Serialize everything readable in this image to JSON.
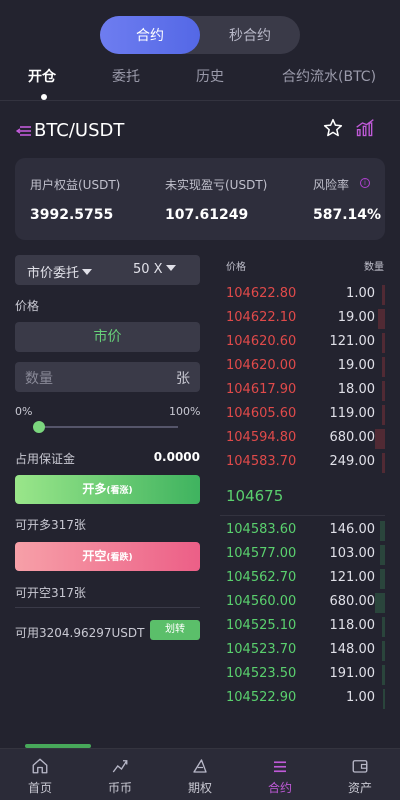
{
  "mode_toggle": {
    "contract": "合约",
    "second_contract": "秒合约"
  },
  "tabs": [
    "开仓",
    "委托",
    "历史",
    "合约流水(BTC)"
  ],
  "pair": {
    "name": "BTC/USDT"
  },
  "account": {
    "equity_label": "用户权益(USDT)",
    "equity_value": "3992.5755",
    "unrealized_label": "未实现盈亏(USDT)",
    "unrealized_value": "107.61249",
    "risk_label": "风险率",
    "risk_value": "587.14%"
  },
  "order_form": {
    "order_type": "市价委托",
    "leverage": "50 X",
    "price_label": "价格",
    "price_value": "市价",
    "qty_placeholder": "数量",
    "qty_unit": "张",
    "slider_min": "0%",
    "slider_max": "100%",
    "slider_value": 0.0,
    "margin_label": "占用保证金",
    "margin_value": "0.0000",
    "long_button": "开多",
    "long_sub": "(看涨)",
    "long_available": "可开多317张",
    "short_button": "开空",
    "short_sub": "(看跌)",
    "short_available": "可开空317张",
    "available_balance": "可用3204.96297USDT",
    "transfer_button": "划转"
  },
  "orderbook": {
    "price_header": "价格",
    "qty_header": "数量",
    "asks": [
      {
        "price": "104622.80",
        "qty": "1.00",
        "depth": 0.02
      },
      {
        "price": "104622.10",
        "qty": "19.00",
        "depth": 0.04
      },
      {
        "price": "104620.60",
        "qty": "121.00",
        "depth": 0.02
      },
      {
        "price": "104620.00",
        "qty": "19.00",
        "depth": 0.02
      },
      {
        "price": "104617.90",
        "qty": "18.00",
        "depth": 0.02
      },
      {
        "price": "104605.60",
        "qty": "119.00",
        "depth": 0.02
      },
      {
        "price": "104594.80",
        "qty": "680.00",
        "depth": 0.06
      },
      {
        "price": "104583.70",
        "qty": "249.00",
        "depth": 0.02
      }
    ],
    "last_price": "104675",
    "bids": [
      {
        "price": "104583.60",
        "qty": "146.00",
        "depth": 0.03
      },
      {
        "price": "104577.00",
        "qty": "103.00",
        "depth": 0.03
      },
      {
        "price": "104562.70",
        "qty": "121.00",
        "depth": 0.03
      },
      {
        "price": "104560.00",
        "qty": "680.00",
        "depth": 0.06
      },
      {
        "price": "104525.10",
        "qty": "118.00",
        "depth": 0.02
      },
      {
        "price": "104523.70",
        "qty": "148.00",
        "depth": 0.02
      },
      {
        "price": "104523.50",
        "qty": "191.00",
        "depth": 0.02
      },
      {
        "price": "104522.90",
        "qty": "1.00",
        "depth": 0.01
      }
    ]
  },
  "bottom_nav": [
    {
      "label": "首页",
      "icon": "home-icon"
    },
    {
      "label": "币币",
      "icon": "spot-icon"
    },
    {
      "label": "期权",
      "icon": "options-icon"
    },
    {
      "label": "合约",
      "icon": "contract-icon",
      "active": true
    },
    {
      "label": "资产",
      "icon": "wallet-icon"
    }
  ],
  "colors": {
    "accent": "#5468e6",
    "buy": "#5ad06e",
    "sell": "#e04a4a",
    "active_nav": "#c05ad8"
  }
}
